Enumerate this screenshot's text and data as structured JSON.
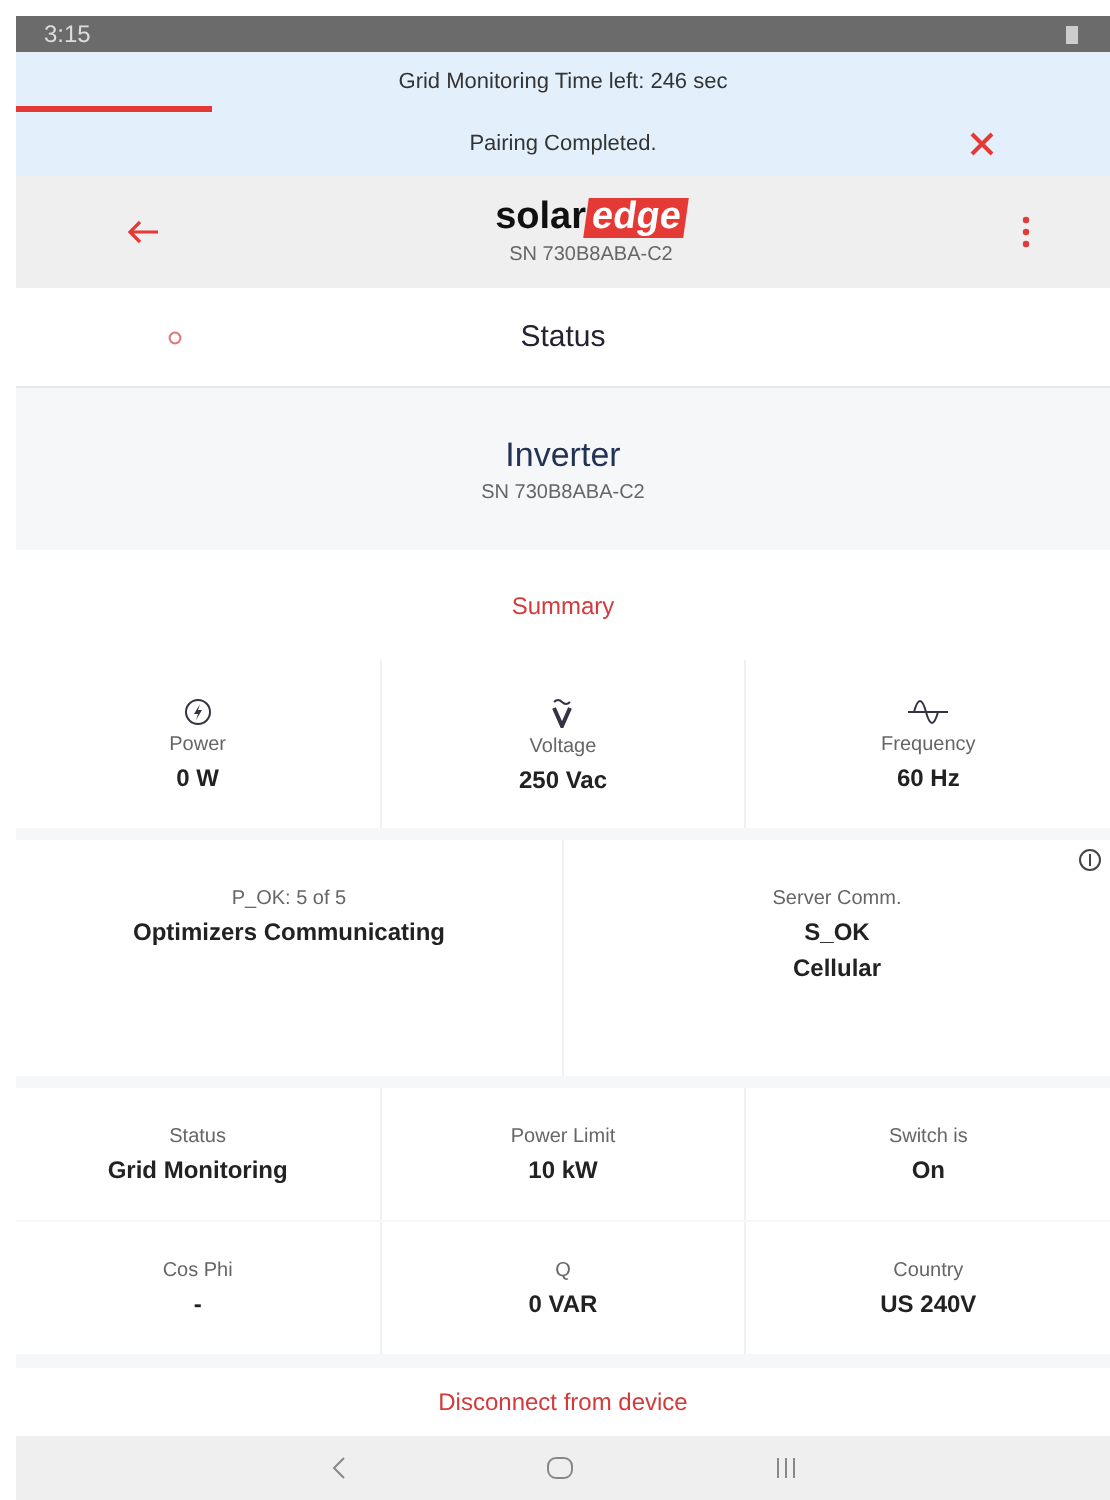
{
  "status_bar": {
    "time": "3:15"
  },
  "banner": {
    "countdown": "Grid Monitoring Time left: 246 sec",
    "progress": {
      "level": 0.18
    },
    "message": "Pairing Completed."
  },
  "header": {
    "logo": [
      "solar",
      "edge"
    ],
    "serial": "SN 730B8ABA-C2"
  },
  "section": {
    "title": "Status"
  },
  "device": {
    "name": "Inverter",
    "serial": "SN 730B8ABA-C2"
  },
  "tab": {
    "label": "Summary"
  },
  "metrics": [
    {
      "kind": "power",
      "label": "Power",
      "value": "0 W"
    },
    {
      "kind": "voltage",
      "label": "Voltage",
      "value": "250 Vac"
    },
    {
      "kind": "frequency",
      "label": "Frequency",
      "value": "60 Hz"
    }
  ],
  "comm": [
    {
      "label": "P_OK: 5 of 5",
      "values": [
        "Optimizers Communicating"
      ]
    },
    {
      "label": "Server Comm.",
      "values": [
        "S_OK",
        "Cellular"
      ]
    }
  ],
  "grid": [
    [
      {
        "label": "Status",
        "value": "Grid Monitoring"
      },
      {
        "label": "Power Limit",
        "value": "10 kW"
      },
      {
        "label": "Switch is",
        "value": "On"
      }
    ],
    [
      {
        "label": "Cos Phi",
        "value": "-"
      },
      {
        "label": "Q",
        "value": "0 VAR"
      },
      {
        "label": "Country",
        "value": "US 240V"
      }
    ]
  ],
  "footer": {
    "action": "Disconnect from device"
  }
}
